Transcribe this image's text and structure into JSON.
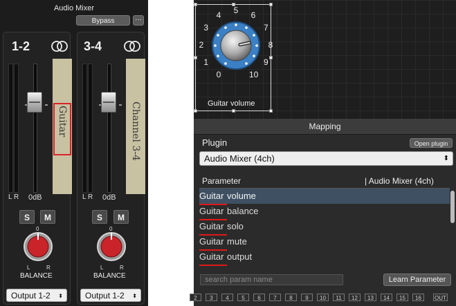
{
  "mixer": {
    "title": "Audio Mixer",
    "bypass_label": "Bypass",
    "more_label": "···",
    "strips": [
      {
        "name": "1-2",
        "tape_label": "Guitar",
        "meter_lr": "L R",
        "db_label": "0dB",
        "solo": "S",
        "mute": "M",
        "knob_zero": "0",
        "knob_l": "L",
        "knob_r": "R",
        "balance_label": "BALANCE",
        "output": "Output 1-2",
        "output_arrow": "⬍"
      },
      {
        "name": "3-4",
        "tape_label": "Channel 3-4",
        "meter_lr": "L R",
        "db_label": "0dB",
        "solo": "S",
        "mute": "M",
        "knob_zero": "0",
        "knob_l": "L",
        "knob_r": "R",
        "balance_label": "BALANCE",
        "output": "Output 1-2",
        "output_arrow": "⬍"
      }
    ]
  },
  "knob_widget": {
    "scale": [
      "0",
      "1",
      "2",
      "3",
      "4",
      "5",
      "6",
      "7",
      "8",
      "9",
      "10"
    ],
    "label": "Guitar volume",
    "value": 7.6,
    "accent": "#3b7fc4"
  },
  "mapping": {
    "header": "Mapping",
    "plugin_label": "Plugin",
    "open_plugin_label": "Open plugin",
    "plugin_selected": "Audio Mixer (4ch)",
    "select_arrow": "⬍",
    "parameter_col": "Parameter",
    "plugin_col": "| Audio Mixer (4ch)",
    "parameters": [
      {
        "prefix": "Guitar",
        "suffix": " volume",
        "selected": true
      },
      {
        "prefix": "Guitar",
        "suffix": " balance",
        "selected": false
      },
      {
        "prefix": "Guitar",
        "suffix": " solo",
        "selected": false
      },
      {
        "prefix": "Guitar",
        "suffix": " mute",
        "selected": false
      },
      {
        "prefix": "Guitar",
        "suffix": " output",
        "selected": false
      }
    ],
    "search_placeholder": "search param name",
    "learn_label": "Learn Parameter",
    "channels": [
      "2",
      "3",
      "4",
      "5",
      "6",
      "7",
      "8",
      "9",
      "10",
      "11",
      "12",
      "13",
      "14",
      "15",
      "16",
      "OUT"
    ]
  },
  "colors": {
    "highlight": "#d8242a",
    "selected_row": "#3e5062",
    "knob_red": "#c8242a"
  }
}
